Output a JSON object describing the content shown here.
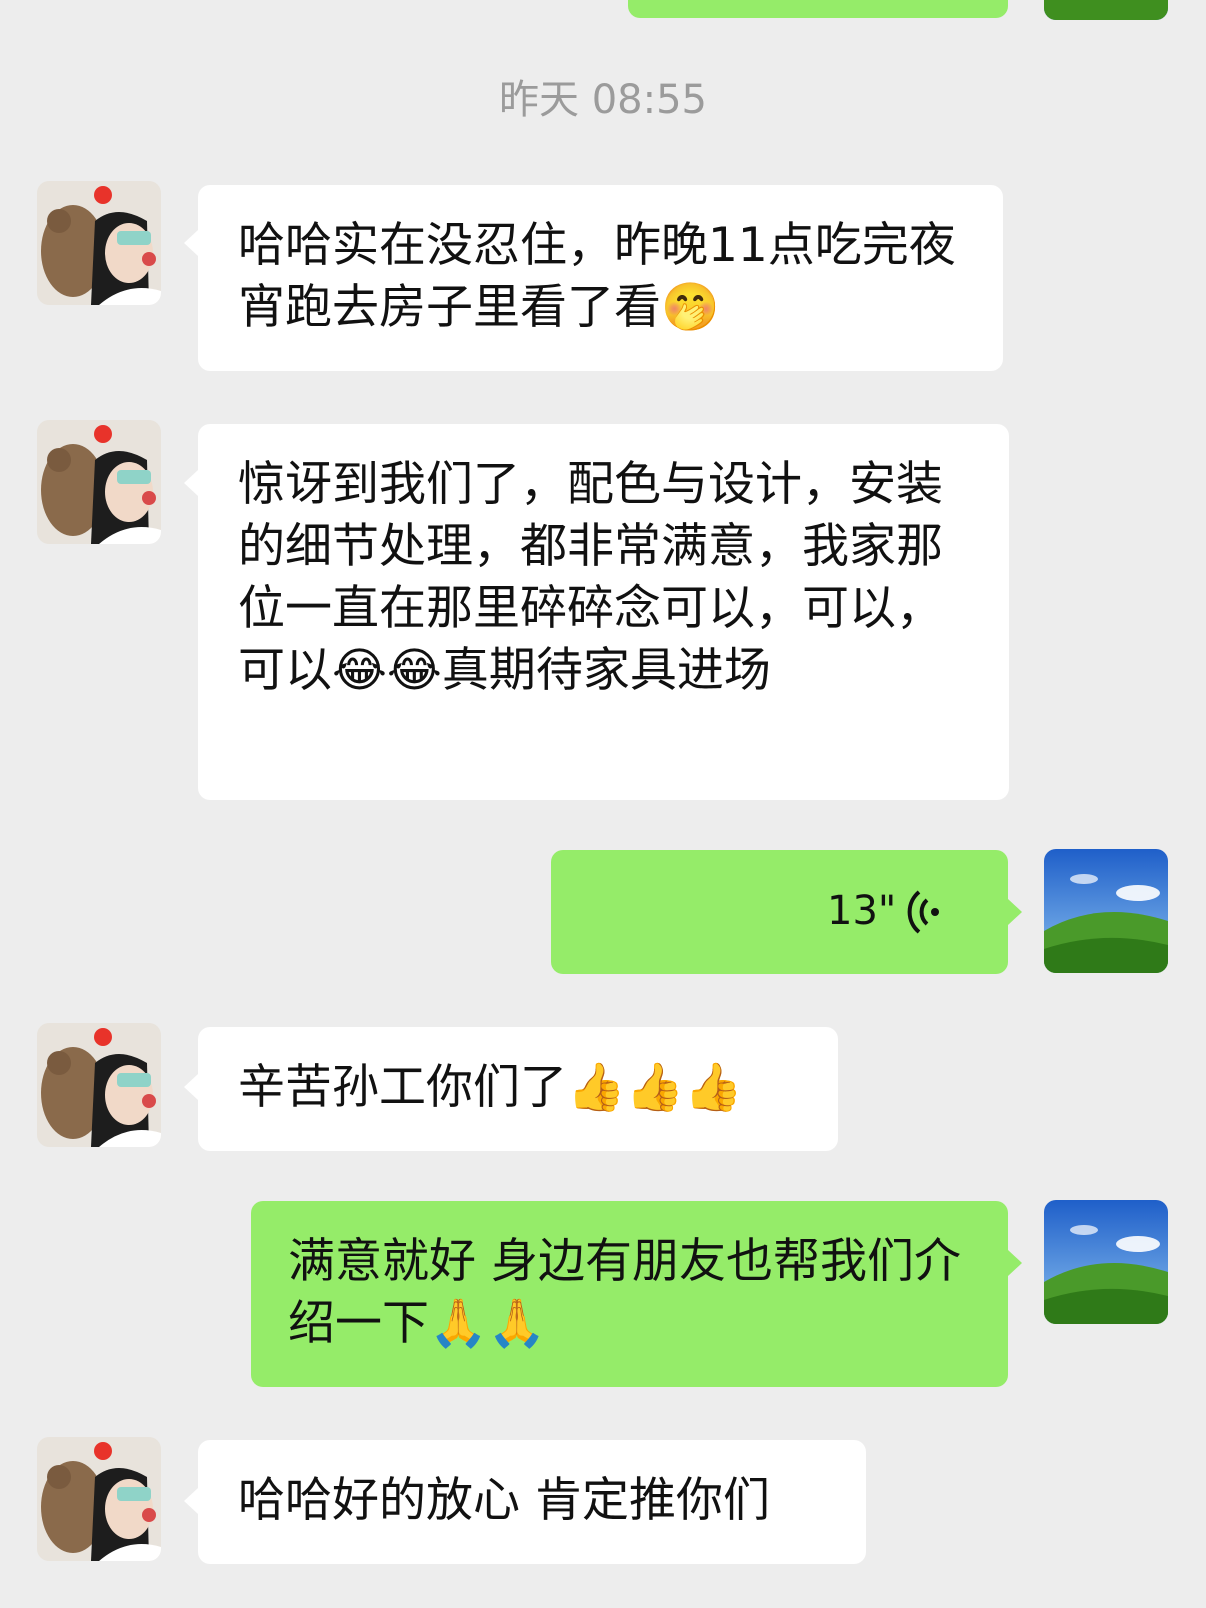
{
  "timestamp": "昨天 08:55",
  "messages": [
    {
      "side": "in",
      "text": "哈哈实在没忍住，昨晚11点吃完夜宵跑去房子里看了看🤭"
    },
    {
      "side": "in",
      "text": "惊讶到我们了，配色与设计，安装的细节处理，都非常满意，我家那位一直在那里碎碎念可以，可以，可以😂😂真期待家具进场"
    },
    {
      "side": "out",
      "type": "voice",
      "duration": "13\""
    },
    {
      "side": "in",
      "text": "辛苦孙工你们了👍👍👍"
    },
    {
      "side": "out",
      "text": "满意就好 身边有朋友也帮我们介绍一下🙏🙏"
    },
    {
      "side": "in",
      "text": "哈哈好的放心 肯定推你们"
    }
  ],
  "colors": {
    "background": "#ededed",
    "incoming_bubble": "#ffffff",
    "outgoing_bubble": "#95ec69",
    "timestamp_text": "#9b9b9b"
  }
}
